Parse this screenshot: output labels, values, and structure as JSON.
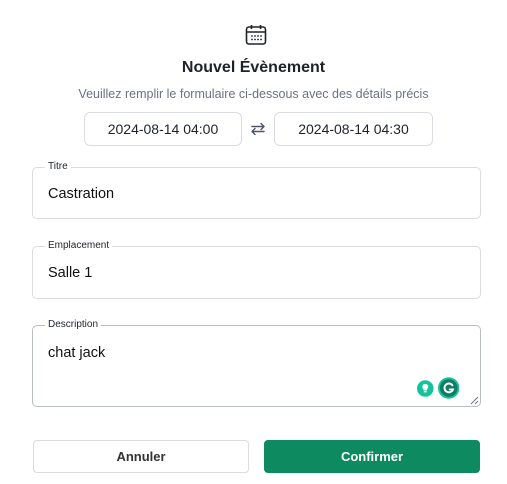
{
  "header": {
    "icon": "calendar-icon",
    "title": "Nouvel Évènement",
    "subtitle": "Veuillez remplir le formulaire ci-dessous avec des détails précis"
  },
  "dates": {
    "start": "2024-08-14 04:00",
    "end": "2024-08-14 04:30",
    "swap_icon": "swap-arrows-icon"
  },
  "form": {
    "titre": {
      "label": "Titre",
      "value": "Castration"
    },
    "emplacement": {
      "label": "Emplacement",
      "value": "Salle 1"
    },
    "description": {
      "label": "Description",
      "value": "chat jack"
    }
  },
  "extensions": {
    "icons": [
      "lightbulb-icon",
      "grammarly-icon"
    ],
    "colors": {
      "grammarly": "#15c39a"
    }
  },
  "actions": {
    "cancel_label": "Annuler",
    "confirm_label": "Confirmer"
  },
  "colors": {
    "accent": "#0d8a5f",
    "border": "#d9dce1",
    "muted_text": "#6b7280"
  }
}
